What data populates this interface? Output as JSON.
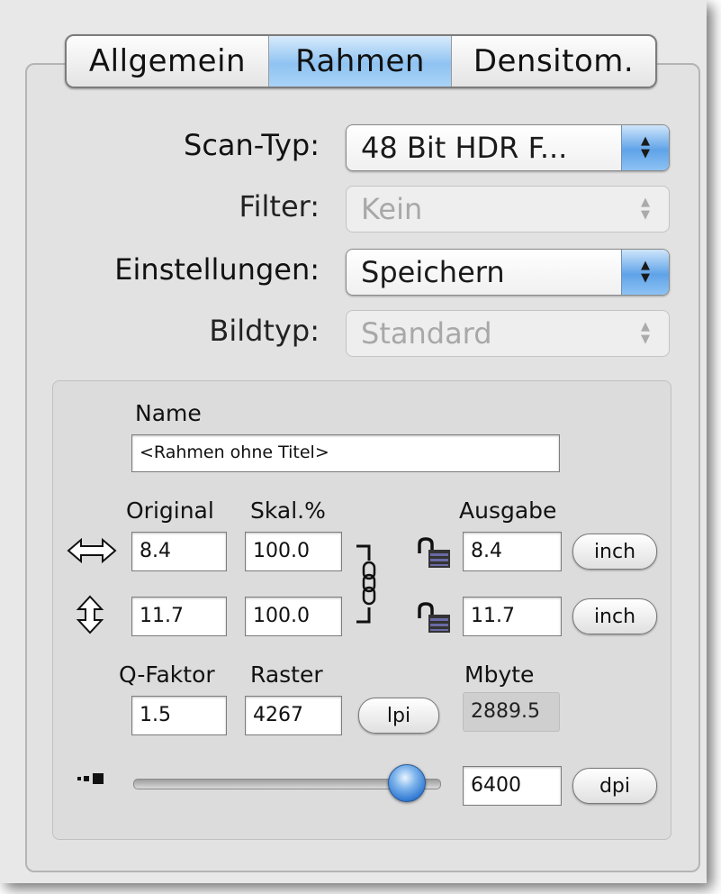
{
  "tabs": [
    "Allgemein",
    "Rahmen",
    "Densitom."
  ],
  "selected_tab": "Rahmen",
  "settings": {
    "scan_type": {
      "label": "Scan-Typ:",
      "value": "48 Bit HDR F..."
    },
    "filter": {
      "label": "Filter:",
      "value": "Kein"
    },
    "einstellungen": {
      "label": "Einstellungen:",
      "value": "Speichern"
    },
    "bildtyp": {
      "label": "Bildtyp:",
      "value": "Standard"
    }
  },
  "frame": {
    "name_label": "Name",
    "name_value": "<Rahmen ohne Titel>",
    "original_label": "Original",
    "skal_label": "Skal.%",
    "ausgabe_label": "Ausgabe",
    "width_original": "8.4",
    "width_scale": "100.0",
    "width_output": "8.4",
    "width_unit": "inch",
    "height_original": "11.7",
    "height_scale": "100.0",
    "height_output": "11.7",
    "height_unit": "inch",
    "qfaktor_label": "Q-Faktor",
    "qfaktor_value": "1.5",
    "raster_label": "Raster",
    "raster_value": "4267",
    "raster_unit": "lpi",
    "mbyte_label": "Mbyte",
    "mbyte_value": "2889.5",
    "resolution_value": "6400",
    "resolution_unit": "dpi",
    "resolution_slider_fraction": 0.85
  },
  "icons": {
    "width": "horizontal-arrows-icon",
    "height": "vertical-arrows-icon",
    "link": "chain-link-icon",
    "lock": "unlocked-padlock-icon",
    "slider_min": "small-squares-icon"
  }
}
